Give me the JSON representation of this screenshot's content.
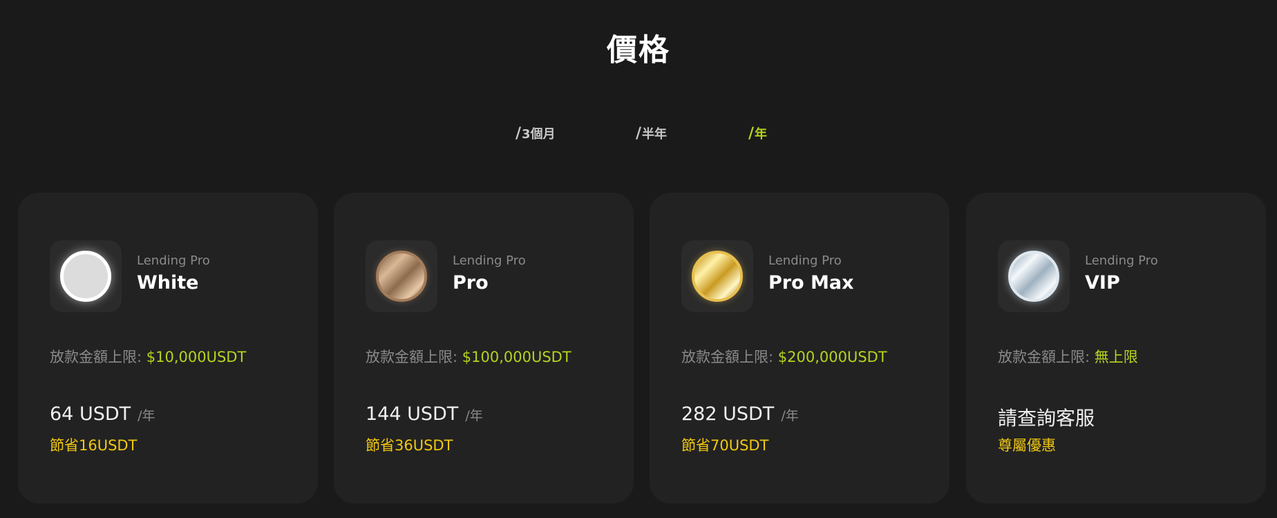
{
  "page": {
    "title": "價格"
  },
  "tabs": [
    {
      "slash": "/",
      "label": "3個月",
      "active": false
    },
    {
      "slash": "/",
      "label": "半年",
      "active": false
    },
    {
      "slash": "/",
      "label": "年",
      "active": true
    }
  ],
  "cards": [
    {
      "badge_icon": "white-coin-icon",
      "product": "Lending Pro",
      "name": "White",
      "limit_label": "放款金額上限:",
      "limit_value": "$10,000USDT",
      "price_amount": "64 USDT",
      "price_period": "/年",
      "save_text": "節省16USDT"
    },
    {
      "badge_icon": "bronze-coin-icon",
      "product": "Lending Pro",
      "name": "Pro",
      "limit_label": "放款金額上限:",
      "limit_value": "$100,000USDT",
      "price_amount": "144 USDT",
      "price_period": "/年",
      "save_text": "節省36USDT"
    },
    {
      "badge_icon": "gold-coin-icon",
      "product": "Lending Pro",
      "name": "Pro Max",
      "limit_label": "放款金額上限:",
      "limit_value": "$200,000USDT",
      "price_amount": "282 USDT",
      "price_period": "/年",
      "save_text": "節省70USDT"
    },
    {
      "badge_icon": "silver-coin-icon",
      "product": "Lending Pro",
      "name": "VIP",
      "limit_label": "放款金額上限:",
      "limit_value": "無上限",
      "price_contact": "請查詢客服",
      "save_text": "尊屬優惠"
    }
  ],
  "colors": {
    "background": "#1a1a1a",
    "card": "#222222",
    "accent_green": "#b6d31f",
    "accent_yellow": "#f2c811",
    "muted_text": "#8a8a8a"
  }
}
